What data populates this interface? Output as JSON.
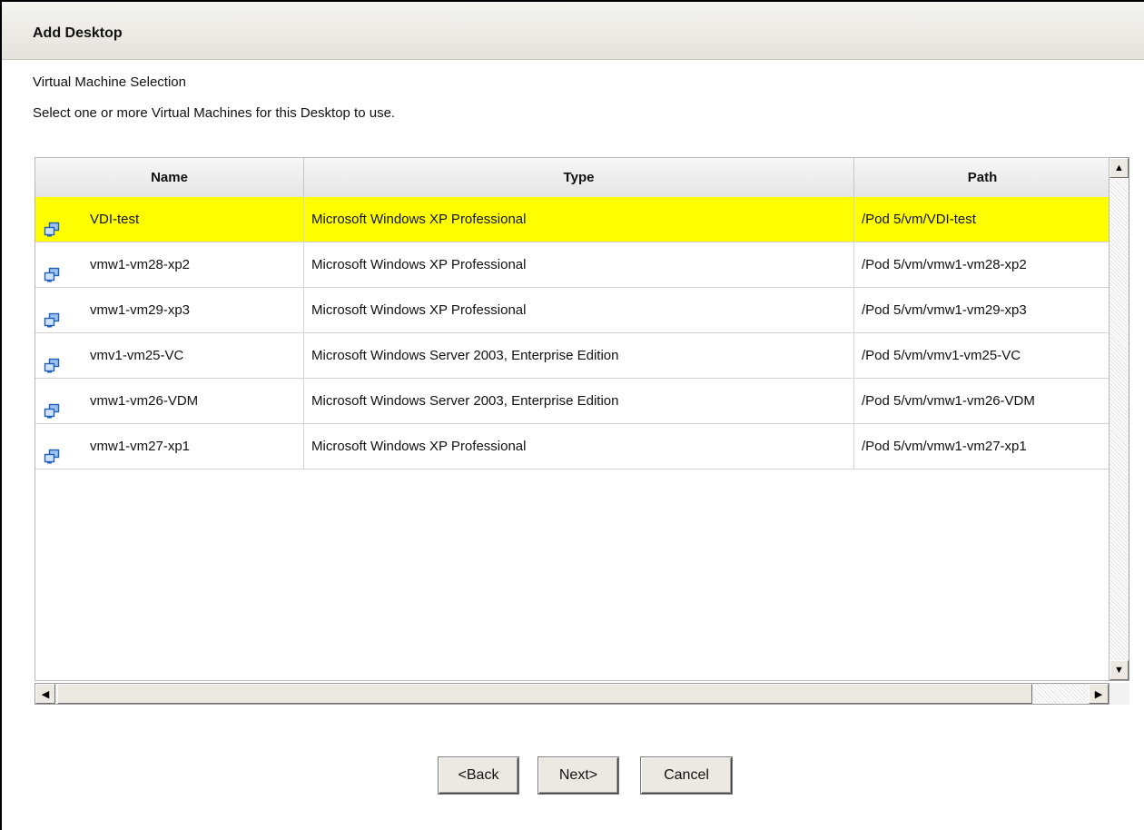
{
  "dialog": {
    "title": "Add Desktop",
    "subtitle": "Virtual Machine Selection",
    "instruction": "Select one or more Virtual Machines for this Desktop to use."
  },
  "table": {
    "columns": [
      "Name",
      "Type",
      "Path"
    ],
    "rows": [
      {
        "name": "VDI-test",
        "type": "Microsoft Windows XP Professional",
        "path": "/Pod 5/vm/VDI-test",
        "selected": true
      },
      {
        "name": "vmw1-vm28-xp2",
        "type": "Microsoft Windows XP Professional",
        "path": "/Pod 5/vm/vmw1-vm28-xp2",
        "selected": false
      },
      {
        "name": "vmw1-vm29-xp3",
        "type": "Microsoft Windows XP Professional",
        "path": "/Pod 5/vm/vmw1-vm29-xp3",
        "selected": false
      },
      {
        "name": "vmv1-vm25-VC",
        "type": "Microsoft Windows Server 2003, Enterprise Edition",
        "path": "/Pod 5/vm/vmv1-vm25-VC",
        "selected": false
      },
      {
        "name": "vmw1-vm26-VDM",
        "type": "Microsoft Windows Server 2003, Enterprise Edition",
        "path": "/Pod 5/vm/vmw1-vm26-VDM",
        "selected": false
      },
      {
        "name": "vmw1-vm27-xp1",
        "type": "Microsoft Windows XP Professional",
        "path": "/Pod 5/vm/vmw1-vm27-xp1",
        "selected": false
      }
    ],
    "row_icon": "virtual-machine-icon"
  },
  "buttons": {
    "back": "<Back",
    "next": "Next>",
    "cancel": "Cancel"
  },
  "scrollbar_icons": {
    "up": "scroll-up-arrow-icon",
    "down": "scroll-down-arrow-icon",
    "left": "scroll-left-arrow-icon",
    "right": "scroll-right-arrow-icon"
  },
  "colors": {
    "selected_row": "#ffff00",
    "title_bar": "#e9e8e2",
    "icon_blue": "#2f6fc4"
  }
}
